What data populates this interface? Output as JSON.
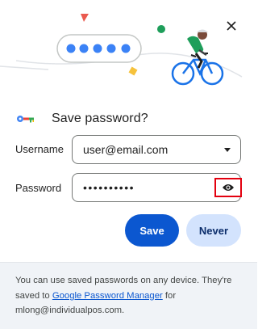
{
  "dialog": {
    "title": "Save password?",
    "username": {
      "label": "Username",
      "value": "user@email.com"
    },
    "password": {
      "label": "Password",
      "masked_value": "••••••••••"
    },
    "buttons": {
      "save": "Save",
      "never": "Never"
    },
    "footer": {
      "text_before_link": "You can use saved passwords on any device. They're saved to ",
      "link_text": "Google Password Manager",
      "text_after_link": " for mlong@individualpos.com."
    }
  },
  "icons": {
    "close": "close-icon",
    "key": "key-icon",
    "dropdown": "chevron-down-icon",
    "show_password": "eye-icon"
  },
  "colors": {
    "primary": "#0b57d0",
    "secondary_button": "#d3e3fd",
    "highlight_box": "#e3000f",
    "footer_bg": "#f0f3f7"
  }
}
